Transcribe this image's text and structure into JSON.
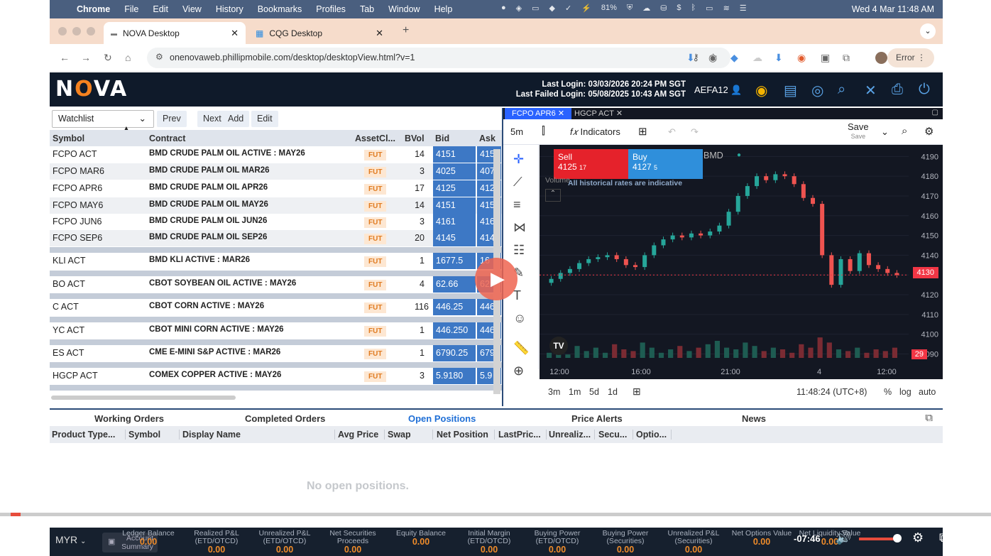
{
  "menubar": {
    "app": "Chrome",
    "items": [
      "File",
      "Edit",
      "View",
      "History",
      "Bookmarks",
      "Profiles",
      "Tab",
      "Window",
      "Help"
    ],
    "battery": "81%",
    "datetime": "Wed 4 Mar  11:48 AM"
  },
  "tabs": [
    {
      "title": "NOVA Desktop"
    },
    {
      "title": "CQG Desktop"
    }
  ],
  "url": "onenovaweb.phillipmobile.com/desktop/desktopView.html?v=1",
  "error_label": "Error",
  "nova": {
    "last_login": "Last Login: 03/03/2026 20:24 PM SGT",
    "last_failed": "Last Failed Login: 05/08/2025 10:43 AM SGT",
    "user": "AEFA12"
  },
  "watchlist": {
    "select": "Watchlist",
    "buttons": [
      "Prev",
      "Next",
      "Add",
      "Edit"
    ],
    "columns": [
      "Symbol",
      "Contract",
      "AssetCl...",
      "BVol",
      "Bid",
      "Ask"
    ],
    "rows": [
      {
        "symbol": "FCPO ACT",
        "contract": "BMD CRUDE PALM OIL ACTIVE : MAY26",
        "asset": "FUT",
        "bvol": "14",
        "bid": "4151",
        "ask": "415"
      },
      {
        "symbol": "FCPO MAR6",
        "contract": "BMD CRUDE PALM OIL MAR26",
        "asset": "FUT",
        "bvol": "3",
        "bid": "4025",
        "ask": "407"
      },
      {
        "symbol": "FCPO APR6",
        "contract": "BMD CRUDE PALM OIL APR26",
        "asset": "FUT",
        "bvol": "17",
        "bid": "4125",
        "ask": "412"
      },
      {
        "symbol": "FCPO MAY6",
        "contract": "BMD CRUDE PALM OIL MAY26",
        "asset": "FUT",
        "bvol": "14",
        "bid": "4151",
        "ask": "415"
      },
      {
        "symbol": "FCPO JUN6",
        "contract": "BMD CRUDE PALM OIL JUN26",
        "asset": "FUT",
        "bvol": "3",
        "bid": "4161",
        "ask": "416"
      },
      {
        "symbol": "FCPO SEP6",
        "contract": "BMD CRUDE PALM OIL SEP26",
        "asset": "FUT",
        "bvol": "20",
        "bid": "4145",
        "ask": "414"
      },
      {
        "symbol": "KLI ACT",
        "contract": "BMD KLI ACTIVE : MAR26",
        "asset": "FUT",
        "bvol": "1",
        "bid": "1677.5",
        "ask": "16"
      },
      {
        "symbol": "BO ACT",
        "contract": "CBOT SOYBEAN OIL ACTIVE : MAY26",
        "asset": "FUT",
        "bvol": "4",
        "bid": "62.66",
        "ask": "62"
      },
      {
        "symbol": "C ACT",
        "contract": "CBOT CORN ACTIVE : MAY26",
        "asset": "FUT",
        "bvol": "116",
        "bid": "446.25",
        "ask": "446"
      },
      {
        "symbol": "YC ACT",
        "contract": "CBOT MINI CORN ACTIVE : MAY26",
        "asset": "FUT",
        "bvol": "1",
        "bid": "446.250",
        "ask": "446"
      },
      {
        "symbol": "ES ACT",
        "contract": "CME E-MINI S&P ACTIVE : MAR26",
        "asset": "FUT",
        "bvol": "1",
        "bid": "6790.25",
        "ask": "679"
      },
      {
        "symbol": "HGCP ACT",
        "contract": "COMEX COPPER ACTIVE : MAY26",
        "asset": "FUT",
        "bvol": "3",
        "bid": "5.9180",
        "ask": "5.9"
      }
    ]
  },
  "chart": {
    "tabs": [
      "FCPO APR6",
      "HGCP ACT"
    ],
    "interval": "5m",
    "indicators": "Indicators",
    "save": "Save",
    "save_sub": "Save",
    "sell_label": "Sell",
    "sell_price": "4125",
    "sell_qty": "17",
    "buy_label": "Buy",
    "buy_price": "4127",
    "buy_qty": "5",
    "exchange": "BMD",
    "notice": "All historical rates are indicative",
    "volume_label": "Volume",
    "last_price": "4130",
    "vol_tag": "29",
    "ranges": [
      "3m",
      "1m",
      "5d",
      "1d"
    ],
    "clock": "11:48:24 (UTC+8)",
    "scale_opts": [
      "%",
      "log",
      "auto"
    ]
  },
  "chart_data": {
    "type": "line",
    "x": [
      "12:00",
      "16:00",
      "21:00",
      "4",
      "12:00"
    ],
    "yticks": [
      4190,
      4180,
      4170,
      4160,
      4150,
      4140,
      4130,
      4120,
      4110,
      4100,
      4090
    ],
    "ylim": [
      4088,
      4193
    ],
    "series": [
      {
        "values": [
          4128,
          4131,
          4133,
          4136,
          4138,
          4139,
          4140,
          4138,
          4135,
          4134,
          4140,
          4145,
          4148,
          4150,
          4149,
          4151,
          4150,
          4152,
          4155,
          4162,
          4170,
          4175,
          4180,
          4178,
          4181,
          4180,
          4176,
          4169,
          4166,
          4140,
          4125,
          4138,
          4132,
          4141,
          4135,
          4133,
          4131,
          4130
        ]
      }
    ],
    "volume": [
      3,
      5,
      2,
      7,
      4,
      6,
      3,
      8,
      5,
      4,
      9,
      6,
      3,
      5,
      7,
      4,
      6,
      8,
      10,
      6,
      5,
      9,
      7,
      4,
      6,
      5,
      3,
      8,
      6,
      12,
      9,
      5,
      4,
      6,
      3,
      5,
      4,
      6
    ]
  },
  "orders": {
    "tabs": [
      "Working Orders",
      "Completed Orders",
      "Open Positions",
      "Price Alerts",
      "News"
    ],
    "active": "Open Positions",
    "columns": [
      "Product Type...",
      "Symbol",
      "Display Name",
      "Avg Price",
      "Swap",
      "Net Position",
      "LastPric...",
      "Unrealiz...",
      "Secu...",
      "Optio..."
    ],
    "empty": "No open positions."
  },
  "footer": {
    "currency": "MYR",
    "account_summary": "Account Summary",
    "cells": [
      {
        "label": "Ledger Balance",
        "value": "0.00"
      },
      {
        "label": "Realized P&L (ETD/OTCD)",
        "value": "0.00"
      },
      {
        "label": "Unrealized P&L (ETD/OTCD)",
        "value": "0.00"
      },
      {
        "label": "Net Securities Proceeds",
        "value": "0.00"
      },
      {
        "label": "Equity Balance",
        "value": "0.00"
      },
      {
        "label": "Initial Margin (ETD/OTCD)",
        "value": "0.00"
      },
      {
        "label": "Buying Power (ETD/OTCD)",
        "value": "0.00"
      },
      {
        "label": "Buying Power (Securities)",
        "value": "0.00"
      },
      {
        "label": "Unrealized P&L (Securities)",
        "value": "0.00"
      },
      {
        "label": "Net Options Value",
        "value": "0.00"
      },
      {
        "label": "Net Liquidity Value",
        "value": "0.00"
      }
    ]
  },
  "video": {
    "time": "-07:46",
    "progress": 0.02,
    "volume": 0.85
  }
}
